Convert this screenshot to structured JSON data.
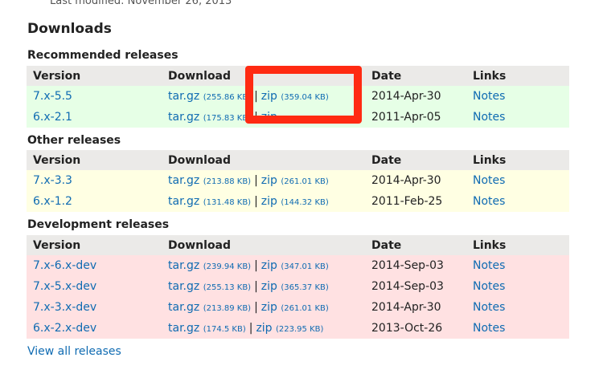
{
  "page": {
    "last_modified": "Last modified: November 26, 2013",
    "heading": "Downloads",
    "view_all": "View all releases"
  },
  "columns": {
    "version": "Version",
    "download": "Download",
    "date": "Date",
    "links": "Links"
  },
  "sections": {
    "recommended": {
      "title": "Recommended releases",
      "rows": [
        {
          "version": "7.x-5.5",
          "tar": "tar.gz",
          "tar_size": "(255.86 KB)",
          "sep": "|",
          "zip": "zip",
          "zip_size": "(359.04 KB)",
          "date": "2014-Apr-30",
          "notes": "Notes"
        },
        {
          "version": "6.x-2.1",
          "tar": "tar.gz",
          "tar_size": "(175.83 KB)",
          "sep": "|",
          "zip": "zip",
          "zip_size": "",
          "date": "2011-Apr-05",
          "notes": "Notes"
        }
      ]
    },
    "other": {
      "title": "Other releases",
      "rows": [
        {
          "version": "7.x-3.3",
          "tar": "tar.gz",
          "tar_size": "(213.88 KB)",
          "sep": "|",
          "zip": "zip",
          "zip_size": "(261.01 KB)",
          "date": "2014-Apr-30",
          "notes": "Notes"
        },
        {
          "version": "6.x-1.2",
          "tar": "tar.gz",
          "tar_size": "(131.48 KB)",
          "sep": "|",
          "zip": "zip",
          "zip_size": "(144.32 KB)",
          "date": "2011-Feb-25",
          "notes": "Notes"
        }
      ]
    },
    "development": {
      "title": "Development releases",
      "rows": [
        {
          "version": "7.x-6.x-dev",
          "tar": "tar.gz",
          "tar_size": "(239.94 KB)",
          "sep": "|",
          "zip": "zip",
          "zip_size": "(347.01 KB)",
          "date": "2014-Sep-03",
          "notes": "Notes"
        },
        {
          "version": "7.x-5.x-dev",
          "tar": "tar.gz",
          "tar_size": "(255.13 KB)",
          "sep": "|",
          "zip": "zip",
          "zip_size": "(365.37 KB)",
          "date": "2014-Sep-03",
          "notes": "Notes"
        },
        {
          "version": "7.x-3.x-dev",
          "tar": "tar.gz",
          "tar_size": "(213.89 KB)",
          "sep": "|",
          "zip": "zip",
          "zip_size": "(261.01 KB)",
          "date": "2014-Apr-30",
          "notes": "Notes"
        },
        {
          "version": "6.x-2.x-dev",
          "tar": "tar.gz",
          "tar_size": "(174.5 KB)",
          "sep": "|",
          "zip": "zip",
          "zip_size": "(223.95 KB)",
          "date": "2013-Oct-26",
          "notes": "Notes"
        }
      ]
    }
  },
  "colors": {
    "link": "#0f6bb2",
    "header_bg": "#ebeae8",
    "recommended_bg": "#e6ffe6",
    "other_bg": "#ffffe3",
    "development_bg": "#ffe1e2",
    "highlight_border": "#ff2a12"
  }
}
